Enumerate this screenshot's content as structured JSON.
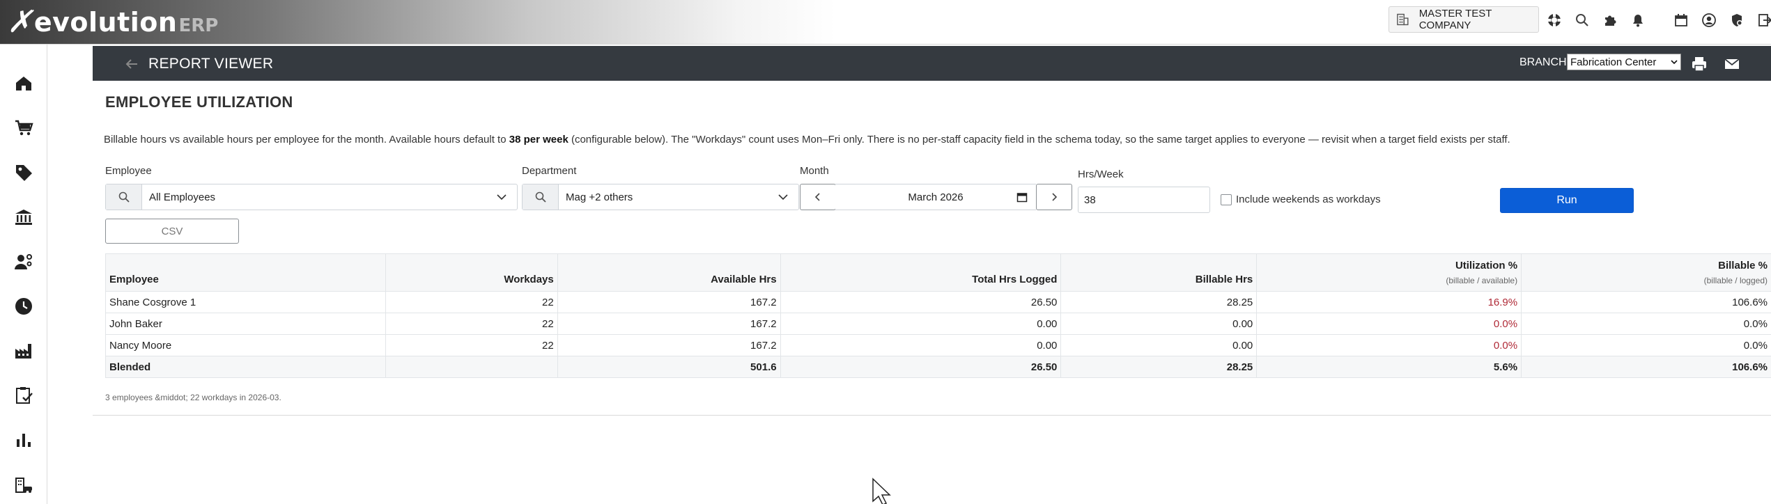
{
  "app": {
    "logo_main": "evolution",
    "logo_suffix": "ERP",
    "company": "MASTER TEST COMPANY"
  },
  "header_icons": [
    "company-building-icon",
    "help-lifebuoy-icon",
    "search-icon",
    "puzzle-icon",
    "bell-icon",
    "calendar-icon",
    "user-circle-icon",
    "security-shield-icon",
    "logout-icon"
  ],
  "sidebar": {
    "items": [
      {
        "icon": "home-icon"
      },
      {
        "icon": "cart-icon"
      },
      {
        "icon": "tag-icon"
      },
      {
        "icon": "bank-icon"
      },
      {
        "icon": "user-settings-icon"
      },
      {
        "icon": "clock-icon"
      },
      {
        "icon": "factory-icon"
      },
      {
        "icon": "clipboard-check-icon"
      },
      {
        "icon": "bar-chart-icon"
      },
      {
        "icon": "building-car-icon"
      }
    ]
  },
  "report_bar": {
    "title": "REPORT VIEWER",
    "branch_label": "BRANCH:",
    "branch_value": "Fabrication Center"
  },
  "page": {
    "heading": "EMPLOYEE UTILIZATION",
    "desc_part1": "Billable hours vs available hours per employee for the month. Available hours default to ",
    "desc_bold": "38 per week",
    "desc_part2": " (configurable below). The \"Workdays\" count uses Mon–Fri only. There is no per-staff capacity field in the schema today, so the same target applies to everyone — revisit when a target field exists per staff."
  },
  "filters": {
    "employee_label": "Employee",
    "employee_value": "All Employees",
    "department_label": "Department",
    "department_value": "Mag +2 others",
    "month_label": "Month",
    "month_value": "March 2026",
    "hrs_label": "Hrs/Week",
    "hrs_value": "38",
    "weekends_label": "Include weekends as workdays",
    "run_label": "Run",
    "csv_label": "CSV"
  },
  "table": {
    "headers": {
      "employee": "Employee",
      "workdays": "Workdays",
      "available": "Available Hrs",
      "total_logged": "Total Hrs Logged",
      "billable": "Billable Hrs",
      "utilization": "Utilization %",
      "utilization_sub": "(billable / available)",
      "billable_pct": "Billable %",
      "billable_pct_sub": "(billable / logged)"
    },
    "rows": [
      {
        "employee": "Shane Cosgrove 1",
        "workdays": "22",
        "available": "167.2",
        "total_logged": "26.50",
        "billable": "28.25",
        "utilization": "16.9%",
        "billable_pct": "106.6%"
      },
      {
        "employee": "John Baker",
        "workdays": "22",
        "available": "167.2",
        "total_logged": "0.00",
        "billable": "0.00",
        "utilization": "0.0%",
        "billable_pct": "0.0%"
      },
      {
        "employee": "Nancy Moore",
        "workdays": "22",
        "available": "167.2",
        "total_logged": "0.00",
        "billable": "0.00",
        "utilization": "0.0%",
        "billable_pct": "0.0%"
      }
    ],
    "total": {
      "employee": "Blended",
      "workdays": "",
      "available": "501.6",
      "total_logged": "26.50",
      "billable": "28.25",
      "utilization": "5.6%",
      "billable_pct": "106.6%"
    },
    "footer": "3 employees &middot; 22 workdays in 2026-03."
  },
  "colors": {
    "header_bar": "#353a40",
    "primary_button": "#0b5ed7",
    "low_utilization": "#b02a37"
  }
}
